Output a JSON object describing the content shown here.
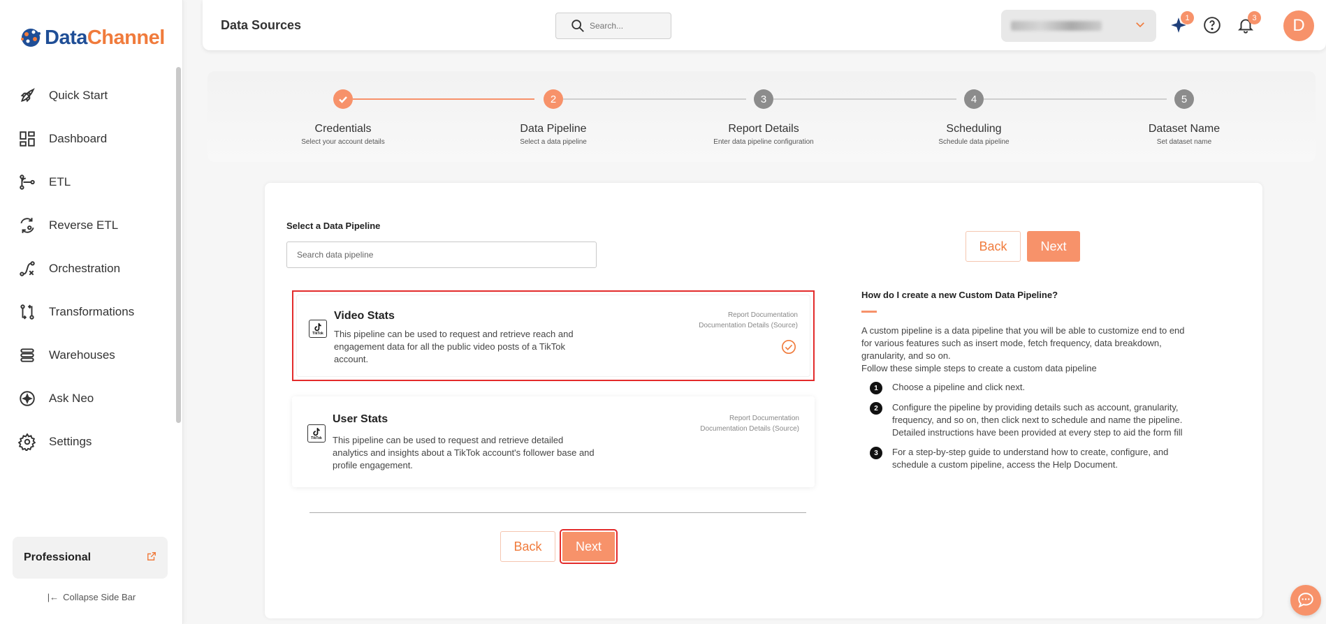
{
  "brand": {
    "name_part1": "Data",
    "name_part2": "Channel"
  },
  "sidebar": {
    "items": [
      {
        "label": "Quick Start",
        "icon": "rocket-icon"
      },
      {
        "label": "Dashboard",
        "icon": "dashboard-icon"
      },
      {
        "label": "ETL",
        "icon": "etl-icon"
      },
      {
        "label": "Reverse ETL",
        "icon": "reverse-etl-icon"
      },
      {
        "label": "Orchestration",
        "icon": "orchestration-icon"
      },
      {
        "label": "Transformations",
        "icon": "transformations-icon"
      },
      {
        "label": "Warehouses",
        "icon": "warehouses-icon"
      },
      {
        "label": "Ask Neo",
        "icon": "ask-neo-icon"
      },
      {
        "label": "Settings",
        "icon": "gear-icon"
      }
    ],
    "plan": "Professional",
    "collapse_label": "Collapse Side Bar"
  },
  "header": {
    "title": "Data Sources",
    "search_placeholder": "Search...",
    "ai_badge": "1",
    "notification_badge": "3",
    "avatar_initial": "D"
  },
  "stepper": {
    "steps": [
      {
        "number": "1",
        "label": "Credentials",
        "sub": "Select your account details",
        "state": "done"
      },
      {
        "number": "2",
        "label": "Data Pipeline",
        "sub": "Select a data pipeline",
        "state": "active"
      },
      {
        "number": "3",
        "label": "Report Details",
        "sub": "Enter data pipeline configuration",
        "state": "pending"
      },
      {
        "number": "4",
        "label": "Scheduling",
        "sub": "Schedule data pipeline",
        "state": "pending"
      },
      {
        "number": "5",
        "label": "Dataset Name",
        "sub": "Set dataset name",
        "state": "pending"
      }
    ]
  },
  "pipeline": {
    "section_title": "Select a Data Pipeline",
    "search_placeholder": "Search data pipeline",
    "items": [
      {
        "name": "Video Stats",
        "description": "This pipeline can be used to request and retrieve reach and engagement data for all the public video posts of a TikTok account.",
        "link1": "Report Documentation",
        "link2": "Documentation Details (Source)",
        "icon_text": "TikTok",
        "selected": true
      },
      {
        "name": "User Stats",
        "description": "This pipeline can be used to request and retrieve detailed analytics and insights about a TikTok account's follower base and profile engagement.",
        "link1": "Report Documentation",
        "link2": "Documentation Details (Source)",
        "icon_text": "TikTok",
        "selected": false
      }
    ]
  },
  "buttons": {
    "back": "Back",
    "next": "Next"
  },
  "help": {
    "title": "How do I create a new Custom Data Pipeline?",
    "intro_1": "A custom pipeline is a data pipeline that you will be able to customize end to end for various features such as insert mode, fetch frequency, data breakdown, granularity, and so on.",
    "intro_2": "Follow these simple steps to create a custom data pipeline",
    "steps": [
      {
        "num": "1",
        "text": "Choose a pipeline and click next."
      },
      {
        "num": "2",
        "text": "Configure the pipeline by providing details such as account, granularity, frequency, and so on, then click next to schedule and name the pipeline. Detailed instructions have been provided at every step to aid the form fill"
      },
      {
        "num": "3",
        "text": "For a step-by-step guide to understand how to create, configure, and schedule a custom pipeline, access the Help Document."
      }
    ]
  },
  "colors": {
    "accent": "#f7926a",
    "accent_dark": "#f07b3c",
    "pending": "#8c8c8c",
    "highlight": "#e32b2b"
  }
}
